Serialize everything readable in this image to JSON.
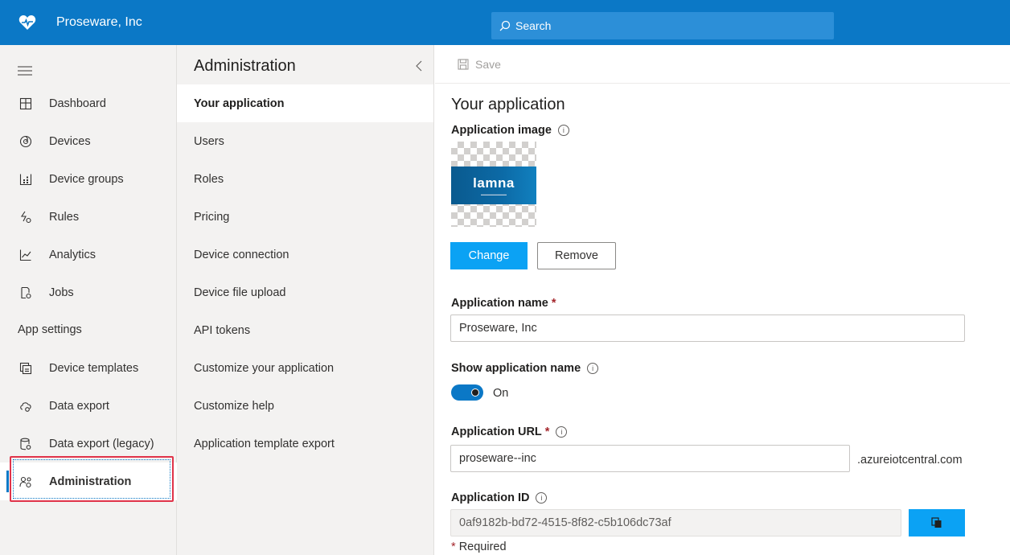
{
  "topbar": {
    "app_name": "Proseware, Inc",
    "search_placeholder": "Search"
  },
  "leftnav": {
    "items": [
      {
        "label": "Dashboard",
        "icon": "dashboard-icon"
      },
      {
        "label": "Devices",
        "icon": "devices-icon"
      },
      {
        "label": "Device groups",
        "icon": "device-groups-icon"
      },
      {
        "label": "Rules",
        "icon": "rules-icon"
      },
      {
        "label": "Analytics",
        "icon": "analytics-icon"
      },
      {
        "label": "Jobs",
        "icon": "jobs-icon"
      }
    ],
    "section_label": "App settings",
    "settings_items": [
      {
        "label": "Device templates",
        "icon": "device-templates-icon"
      },
      {
        "label": "Data export",
        "icon": "data-export-icon"
      },
      {
        "label": "Data export (legacy)",
        "icon": "data-export-legacy-icon"
      },
      {
        "label": "Administration",
        "icon": "administration-icon",
        "active": true
      }
    ]
  },
  "midpanel": {
    "title": "Administration",
    "items": [
      {
        "label": "Your application",
        "active": true
      },
      {
        "label": "Users"
      },
      {
        "label": "Roles"
      },
      {
        "label": "Pricing"
      },
      {
        "label": "Device connection"
      },
      {
        "label": "Device file upload"
      },
      {
        "label": "API tokens"
      },
      {
        "label": "Customize your application"
      },
      {
        "label": "Customize help"
      },
      {
        "label": "Application template export"
      }
    ]
  },
  "main": {
    "save_label": "Save",
    "title": "Your application",
    "app_image_label": "Application image",
    "logo_text": "lamna",
    "change_label": "Change",
    "remove_label": "Remove",
    "app_name_label": "Application name",
    "app_name_value": "Proseware, Inc",
    "show_name_label": "Show application name",
    "toggle_state": "On",
    "app_url_label": "Application URL",
    "app_url_value": "proseware--inc",
    "app_url_suffix": ".azureiotcentral.com",
    "app_id_label": "Application ID",
    "app_id_value": "0af9182b-bd72-4515-8f82-c5b106dc73af",
    "required_note": "Required",
    "required_mark": "*",
    "info_glyph": "i"
  },
  "colors": {
    "topbar": "#0b78c6",
    "primary_button": "#0ba2f4",
    "highlight_box": "#e0344a"
  }
}
